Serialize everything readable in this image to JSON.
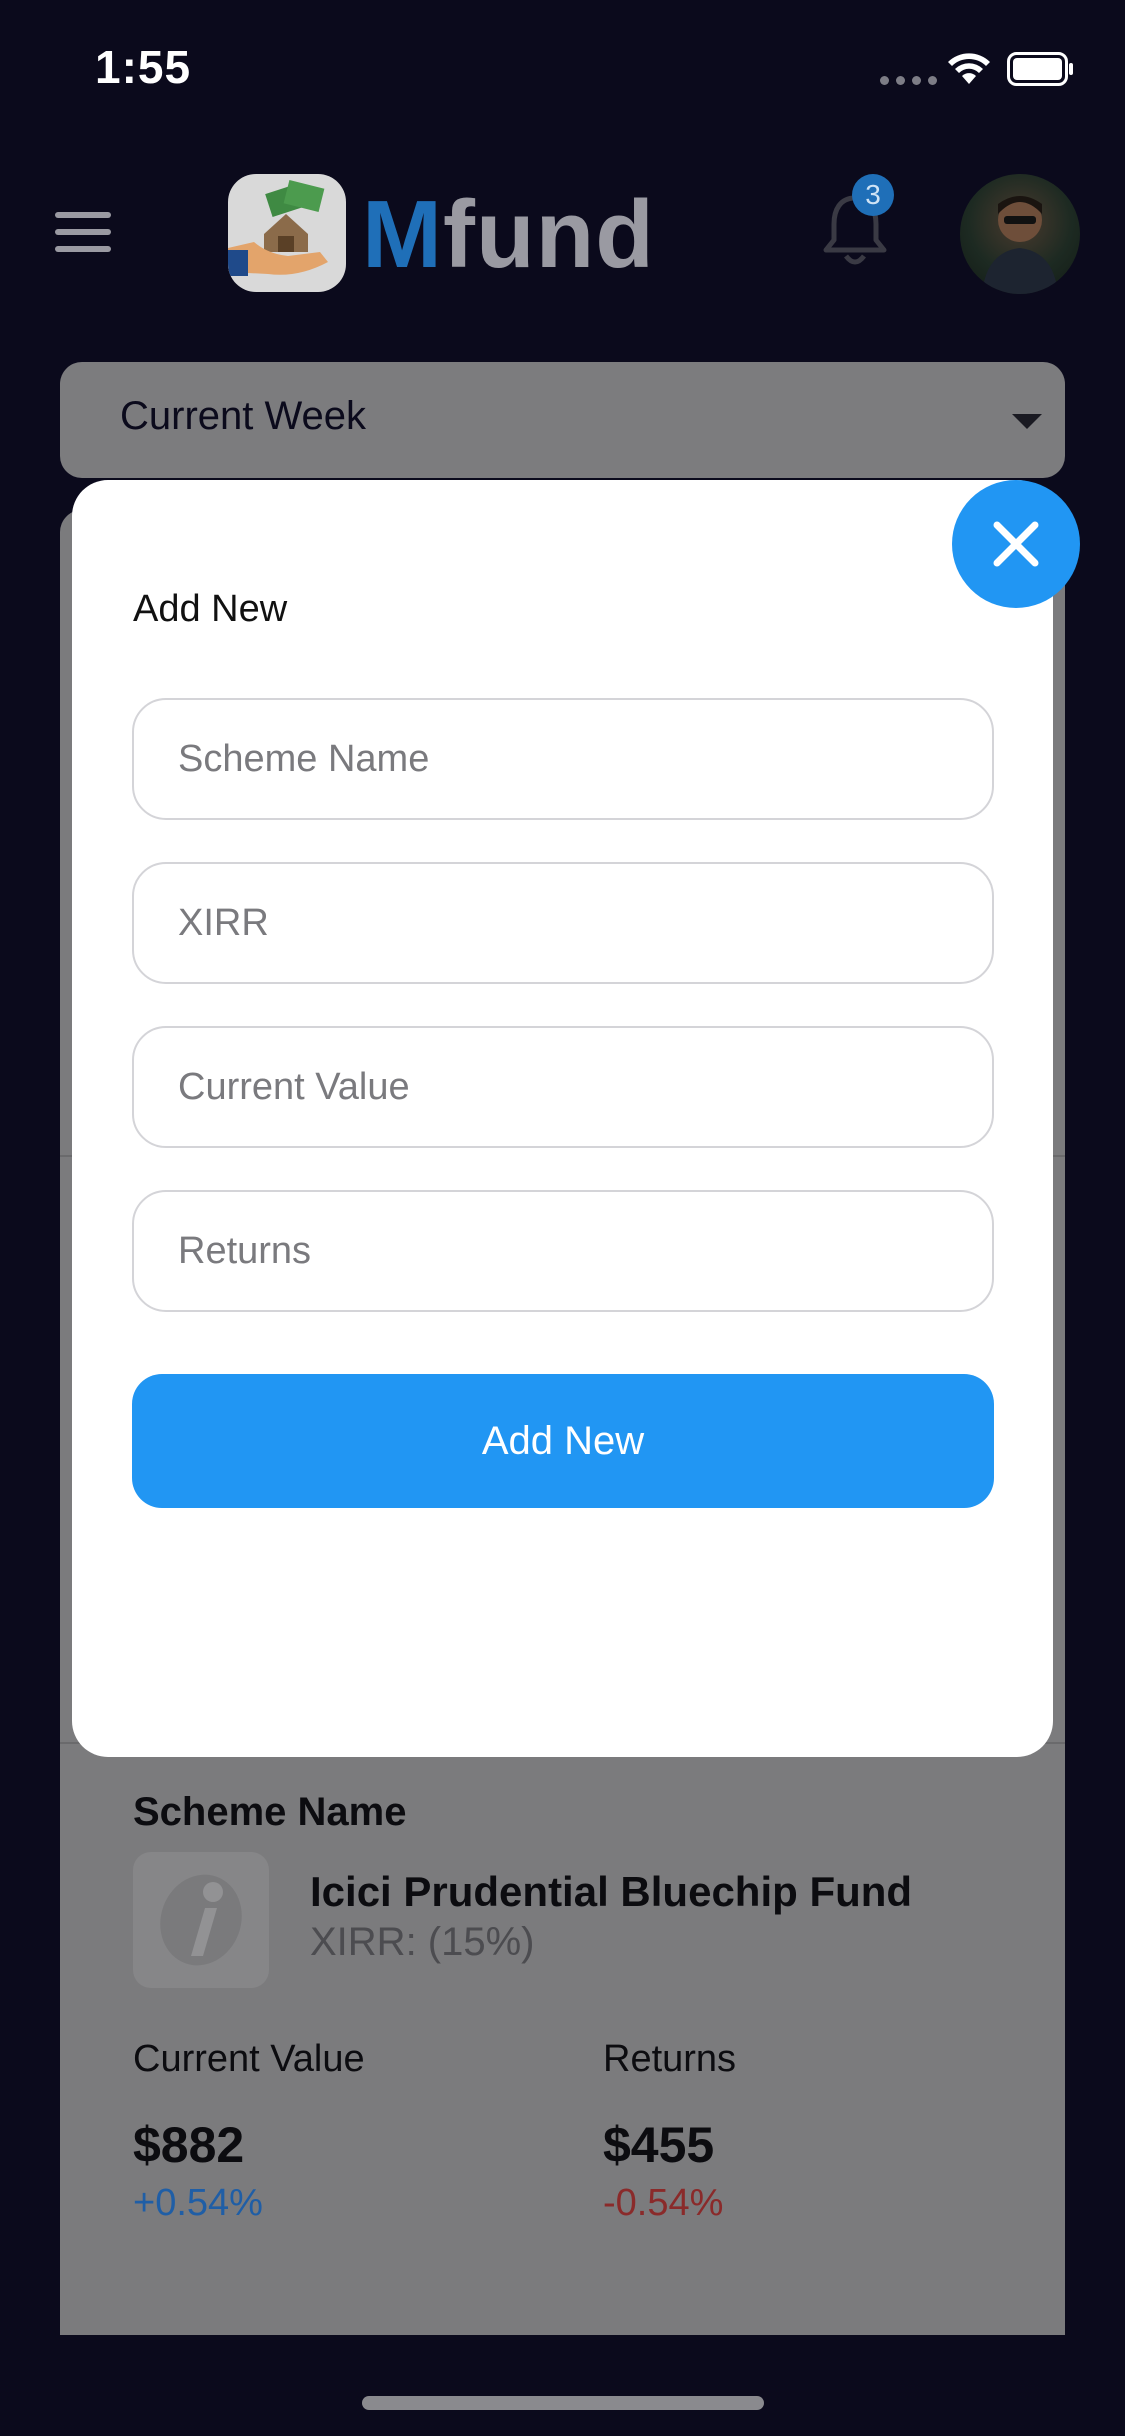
{
  "status_bar": {
    "time": "1:55",
    "icons": [
      "signal-dots-icon",
      "wifi-icon",
      "battery-icon"
    ]
  },
  "header": {
    "logo_initial": "M",
    "logo_rest": "fund",
    "notification_count": "3",
    "icons": [
      "menu-icon",
      "logo-icon",
      "bell-icon",
      "avatar"
    ]
  },
  "filter": {
    "selected": "Current Week"
  },
  "modal": {
    "title": "Add New",
    "fields": [
      {
        "placeholder": "Scheme Name"
      },
      {
        "placeholder": "XIRR"
      },
      {
        "placeholder": "Current Value"
      },
      {
        "placeholder": "Returns"
      }
    ],
    "submit_label": "Add New",
    "accent_color": "#2196F3"
  },
  "scheme_card": {
    "section_title": "Scheme Name",
    "fund_name": "Icici Prudential Bluechip Fund",
    "xirr": "XIRR: (15%)",
    "current_value_label": "Current Value",
    "current_value": "$882",
    "current_value_change": "+0.54%",
    "returns_label": "Returns",
    "returns_value": "$455",
    "returns_change": "-0.54%"
  }
}
